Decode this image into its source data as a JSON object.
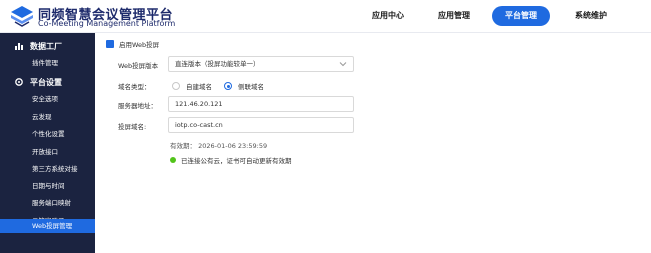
{
  "brand": {
    "title": "同频智慧会议管理平台",
    "subtitle": "Co-Meeting Management Platform",
    "color": "#1d2a6b"
  },
  "topnav": [
    {
      "label": "应用中心",
      "active": false
    },
    {
      "label": "应用管理",
      "active": false
    },
    {
      "label": "平台管理",
      "active": true
    },
    {
      "label": "系统维护",
      "active": false
    }
  ],
  "sidebar": {
    "groups": [
      {
        "label": "数据工厂",
        "icon": "chart-icon"
      },
      {
        "label": "平台设置",
        "icon": "settings-icon"
      }
    ],
    "items": [
      {
        "label": "插件管理"
      },
      {
        "label": "安全选项"
      },
      {
        "label": "云发现"
      },
      {
        "label": "个性化设置"
      },
      {
        "label": "开放接口"
      },
      {
        "label": "第三方系统对接"
      },
      {
        "label": "日期与时间"
      },
      {
        "label": "服务端口映射"
      },
      {
        "label": "云管家登录"
      },
      {
        "label": "Web投屏管理",
        "active": true
      }
    ]
  },
  "form": {
    "enable_label": "启用Web投屏",
    "enable_checked": true,
    "version_label": "Web投屏版本",
    "version_value": "直连版本（投屏功能较单一）",
    "domain_type_label": "域名类型：",
    "domain_type_options": [
      {
        "label": "自建域名",
        "selected": false
      },
      {
        "label": "侧联域名",
        "selected": true
      }
    ],
    "server_label": "服务器地址：",
    "server_value": "121.46.20.121",
    "cast_domain_label": "投屏域名:",
    "cast_domain_value": "iotp.co-cast.cn",
    "valid_until": "有效期：  2026-01-06 23:59:59",
    "status_text": "已连接公有云，证书可自动更新有效期"
  },
  "colors": {
    "accent": "#1f6ae0",
    "sidebar_bg": "#1b2340",
    "status_ok": "#52c41a"
  }
}
